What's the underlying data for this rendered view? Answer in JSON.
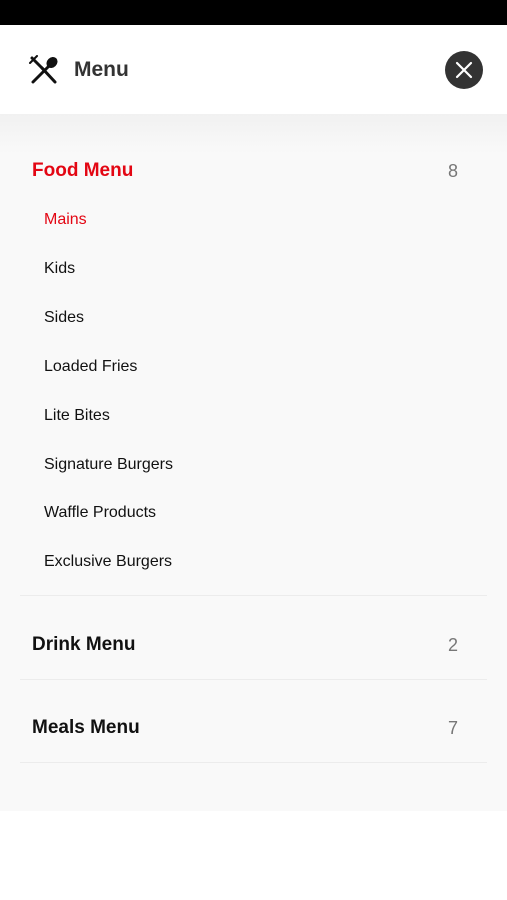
{
  "header": {
    "title": "Menu",
    "icon": "fork-and-knife-icon",
    "close_icon": "close-icon"
  },
  "colors": {
    "accent": "#e30613",
    "close_button_bg": "#333333",
    "panel_bg": "#f9f9f9"
  },
  "sections": [
    {
      "title": "Food Menu",
      "count": "8",
      "expanded": true,
      "items": [
        {
          "label": "Mains",
          "active": true
        },
        {
          "label": "Kids"
        },
        {
          "label": "Sides"
        },
        {
          "label": "Loaded Fries"
        },
        {
          "label": "Lite Bites"
        },
        {
          "label": "Signature Burgers"
        },
        {
          "label": "Waffle Products"
        },
        {
          "label": "Exclusive Burgers"
        }
      ]
    },
    {
      "title": "Drink Menu",
      "count": "2",
      "expanded": false
    },
    {
      "title": "Meals Menu",
      "count": "7",
      "expanded": false
    }
  ]
}
